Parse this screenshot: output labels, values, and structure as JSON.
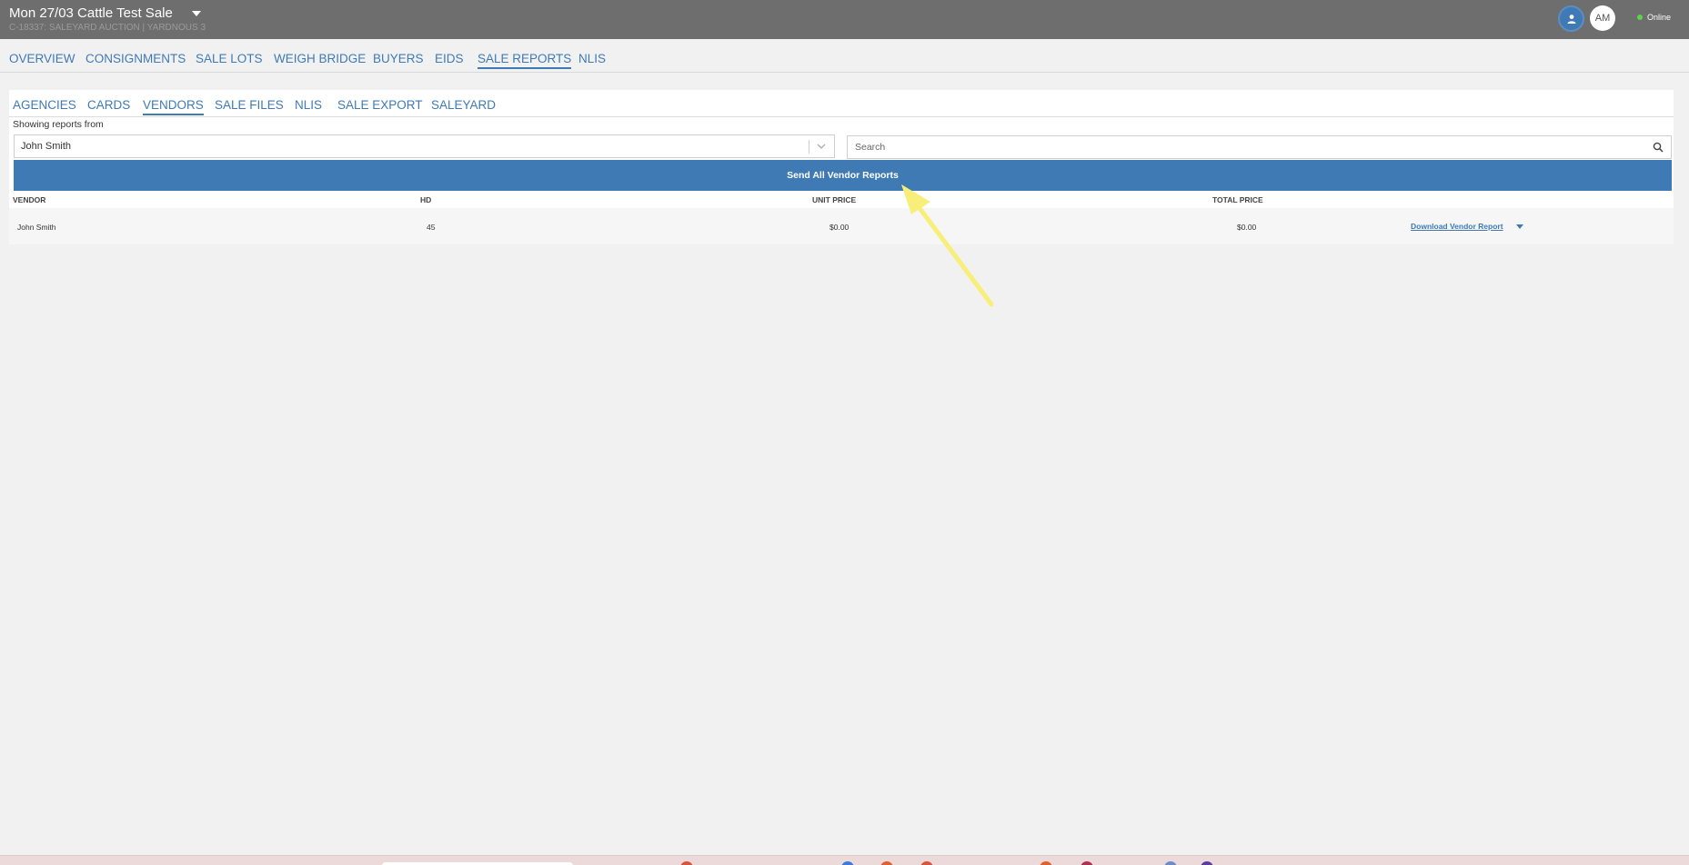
{
  "header": {
    "sale_title": "Mon 27/03 Cattle Test Sale",
    "sale_subtitle": "C-18337: SALEYARD AUCTION | YARDNOUS 3",
    "avatar_initials": "AM",
    "status_label": "Online",
    "status_color": "#5fd34d"
  },
  "main_tabs": [
    "OVERVIEW",
    "CONSIGNMENTS",
    "SALE LOTS",
    "WEIGH BRIDGE",
    "BUYERS",
    "EIDS",
    "SALE REPORTS",
    "NLIS"
  ],
  "active_main_tab": "SALE REPORTS",
  "sub_tabs": [
    "AGENCIES",
    "CARDS",
    "VENDORS",
    "SALE FILES",
    "NLIS",
    "SALE EXPORT",
    "SALEYARD"
  ],
  "active_sub_tab": "VENDORS",
  "filter": {
    "label": "Showing reports from",
    "selected": "John Smith",
    "search_placeholder": "Search"
  },
  "send_button_label": "Send All Vendor Reports",
  "table": {
    "columns": [
      "VENDOR",
      "HD",
      "UNIT PRICE",
      "TOTAL PRICE"
    ],
    "rows": [
      {
        "vendor": "John Smith",
        "hd": "45",
        "unit_price": "$0.00",
        "total_price": "$0.00",
        "action": "Download Vendor Report"
      }
    ]
  },
  "colors": {
    "accent": "#3f7ab4",
    "topbar": "#6e6e6e",
    "annotation_arrow": "#f7ef7a"
  },
  "icons": [
    "caret-down-icon",
    "user-icon",
    "chevron-down-icon",
    "search-icon",
    "annotation-arrow"
  ]
}
